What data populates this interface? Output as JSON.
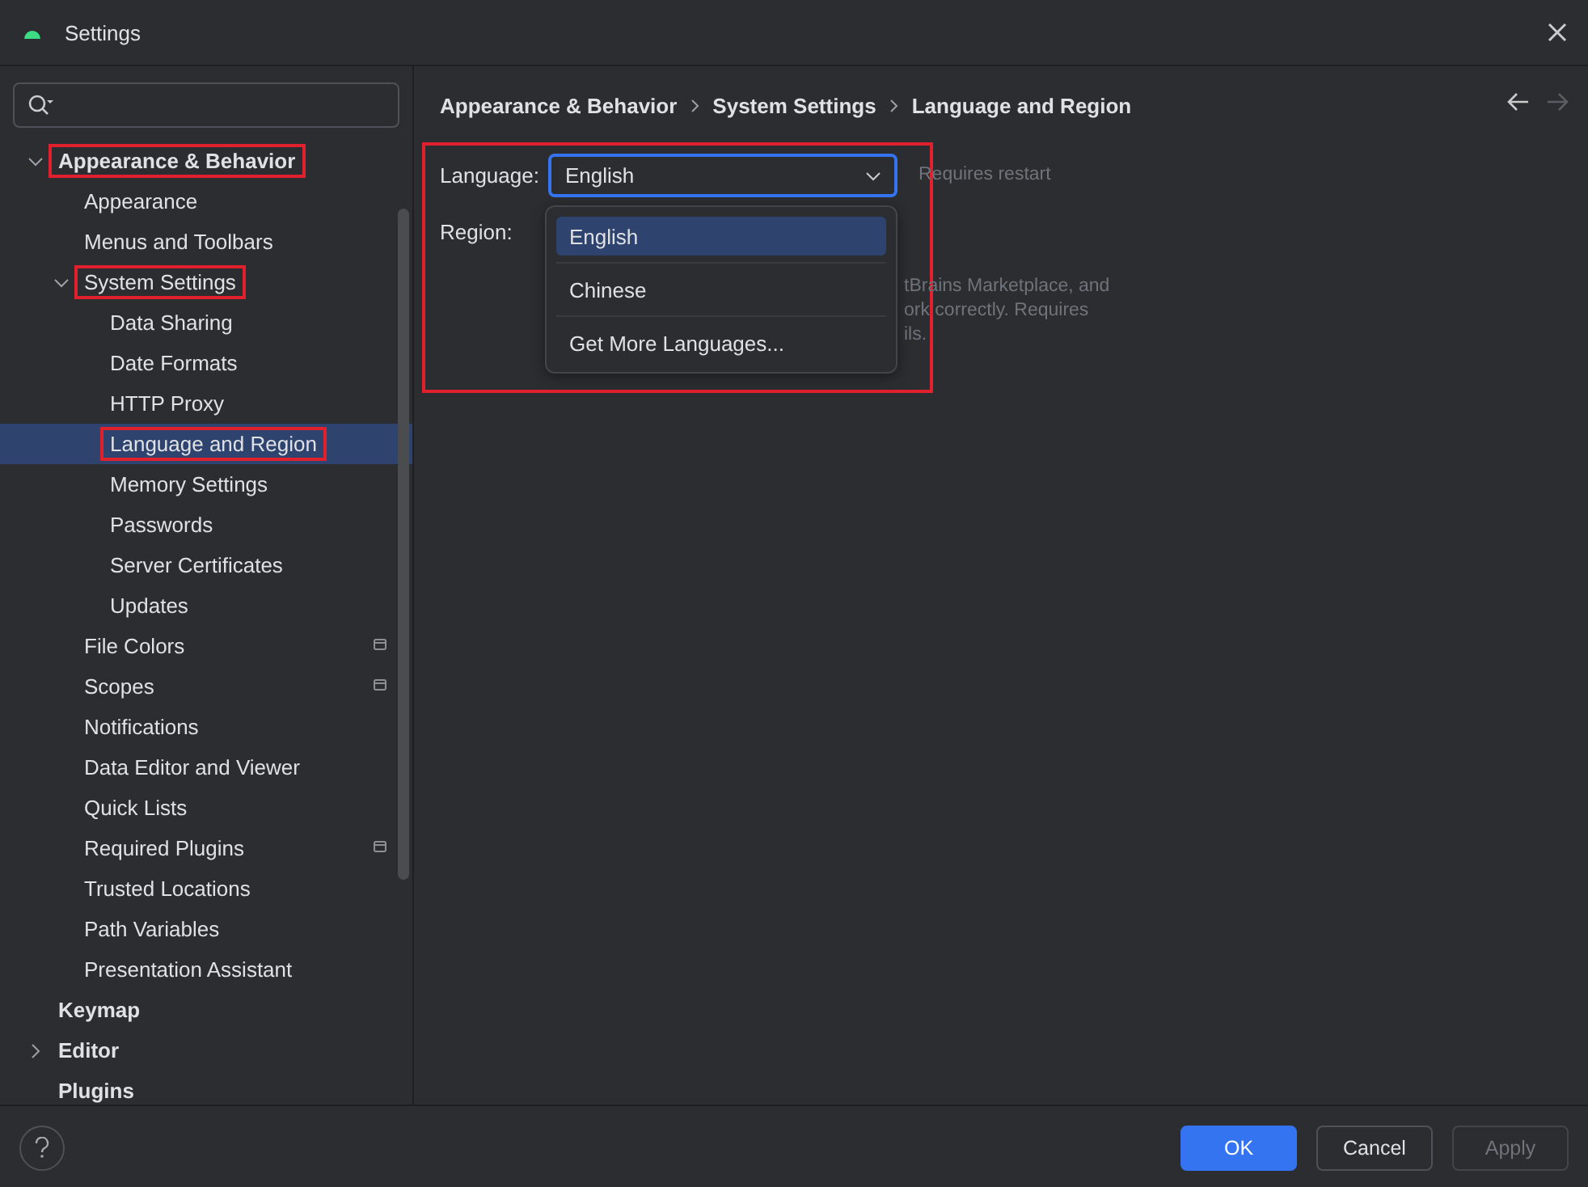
{
  "window": {
    "title": "Settings"
  },
  "tree": [
    {
      "label": "Appearance & Behavior",
      "expanded": true,
      "highlighted": true,
      "selected": false,
      "children": [
        {
          "label": "Appearance",
          "selected": false,
          "highlighted": false
        },
        {
          "label": "Menus and Toolbars",
          "selected": false,
          "highlighted": false
        },
        {
          "label": "System Settings",
          "expanded": true,
          "highlighted": true,
          "selected": false,
          "children": [
            {
              "label": "Data Sharing",
              "selected": false,
              "highlighted": false
            },
            {
              "label": "Date Formats",
              "selected": false,
              "highlighted": false
            },
            {
              "label": "HTTP Proxy",
              "selected": false,
              "highlighted": false
            },
            {
              "label": "Language and Region",
              "selected": true,
              "highlighted": true
            },
            {
              "label": "Memory Settings",
              "selected": false,
              "highlighted": false
            },
            {
              "label": "Passwords",
              "selected": false,
              "highlighted": false
            },
            {
              "label": "Server Certificates",
              "selected": false,
              "highlighted": false
            },
            {
              "label": "Updates",
              "selected": false,
              "highlighted": false
            }
          ]
        },
        {
          "label": "File Colors",
          "selected": false,
          "highlighted": false,
          "project_level": true
        },
        {
          "label": "Scopes",
          "selected": false,
          "highlighted": false,
          "project_level": true
        },
        {
          "label": "Notifications",
          "selected": false,
          "highlighted": false
        },
        {
          "label": "Data Editor and Viewer",
          "selected": false,
          "highlighted": false
        },
        {
          "label": "Quick Lists",
          "selected": false,
          "highlighted": false
        },
        {
          "label": "Required Plugins",
          "selected": false,
          "highlighted": false,
          "project_level": true
        },
        {
          "label": "Trusted Locations",
          "selected": false,
          "highlighted": false
        },
        {
          "label": "Path Variables",
          "selected": false,
          "highlighted": false
        },
        {
          "label": "Presentation Assistant",
          "selected": false,
          "highlighted": false
        }
      ]
    },
    {
      "label": "Keymap",
      "selected": false,
      "highlighted": false
    },
    {
      "label": "Editor",
      "expanded": false,
      "selected": false,
      "highlighted": false
    },
    {
      "label": "Plugins",
      "selected": false,
      "highlighted": false
    }
  ],
  "breadcrumbs": [
    "Appearance & Behavior",
    "System Settings",
    "Language and Region"
  ],
  "content": {
    "highlighted": true,
    "language": {
      "label": "Language:",
      "value": "English",
      "hint": "Requires restart"
    },
    "region": {
      "label": "Region:"
    },
    "note_lines": [
      "tBrains Marketplace, and",
      "ork correctly. Requires",
      "ils."
    ],
    "dropdown": [
      {
        "label": "English",
        "selected": true
      },
      {
        "label": "Chinese",
        "selected": false
      },
      {
        "label": "Get More Languages...",
        "selected": false
      }
    ]
  },
  "footer": {
    "buttons": [
      {
        "label": "OK",
        "kind": "primary",
        "disabled": false
      },
      {
        "label": "Cancel",
        "kind": "normal",
        "disabled": false
      },
      {
        "label": "Apply",
        "kind": "normal",
        "disabled": true
      }
    ]
  }
}
